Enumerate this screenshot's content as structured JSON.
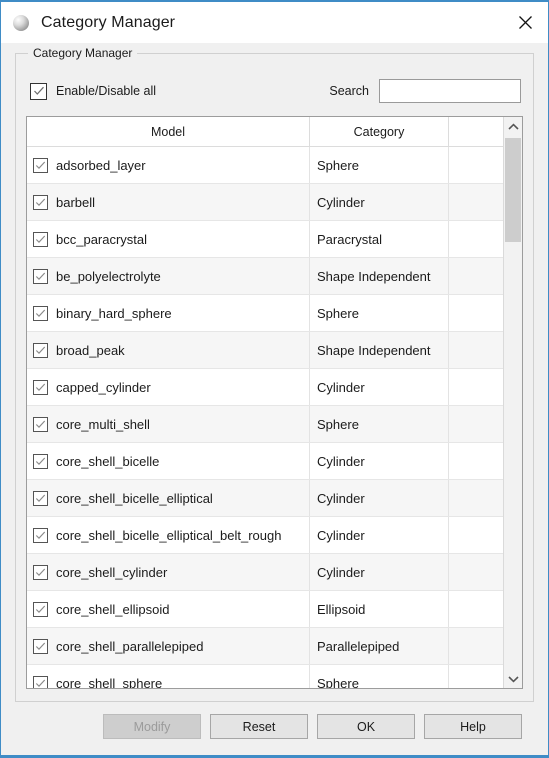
{
  "window": {
    "title": "Category Manager",
    "icon": "sphere-icon",
    "close_icon": "close-icon",
    "border_color": "#3f8cc6"
  },
  "group": {
    "legend": "Category Manager"
  },
  "controls": {
    "enable_all": {
      "label": "Enable/Disable all",
      "checked": true,
      "icon": "checkmark-icon"
    },
    "search": {
      "label": "Search",
      "value": "",
      "placeholder": ""
    }
  },
  "table": {
    "columns": [
      "Model",
      "Category"
    ],
    "rows": [
      {
        "checked": true,
        "model": "adsorbed_layer",
        "category": "Sphere"
      },
      {
        "checked": true,
        "model": "barbell",
        "category": "Cylinder"
      },
      {
        "checked": true,
        "model": "bcc_paracrystal",
        "category": "Paracrystal"
      },
      {
        "checked": true,
        "model": "be_polyelectrolyte",
        "category": "Shape Independent"
      },
      {
        "checked": true,
        "model": "binary_hard_sphere",
        "category": "Sphere"
      },
      {
        "checked": true,
        "model": "broad_peak",
        "category": "Shape Independent"
      },
      {
        "checked": true,
        "model": "capped_cylinder",
        "category": "Cylinder"
      },
      {
        "checked": true,
        "model": "core_multi_shell",
        "category": "Sphere"
      },
      {
        "checked": true,
        "model": "core_shell_bicelle",
        "category": "Cylinder"
      },
      {
        "checked": true,
        "model": "core_shell_bicelle_elliptical",
        "category": "Cylinder"
      },
      {
        "checked": true,
        "model": "core_shell_bicelle_elliptical_belt_rough",
        "category": "Cylinder"
      },
      {
        "checked": true,
        "model": "core_shell_cylinder",
        "category": "Cylinder"
      },
      {
        "checked": true,
        "model": "core_shell_ellipsoid",
        "category": "Ellipsoid"
      },
      {
        "checked": true,
        "model": "core_shell_parallelepiped",
        "category": "Parallelepiped"
      },
      {
        "checked": true,
        "model": "core_shell_sphere",
        "category": "Sphere"
      }
    ]
  },
  "scrollbar": {
    "up_icon": "chevron-up-icon",
    "down_icon": "chevron-down-icon"
  },
  "footer": {
    "buttons": [
      {
        "label": "Modify",
        "enabled": false
      },
      {
        "label": "Reset",
        "enabled": true
      },
      {
        "label": "OK",
        "enabled": true
      },
      {
        "label": "Help",
        "enabled": true
      }
    ]
  }
}
